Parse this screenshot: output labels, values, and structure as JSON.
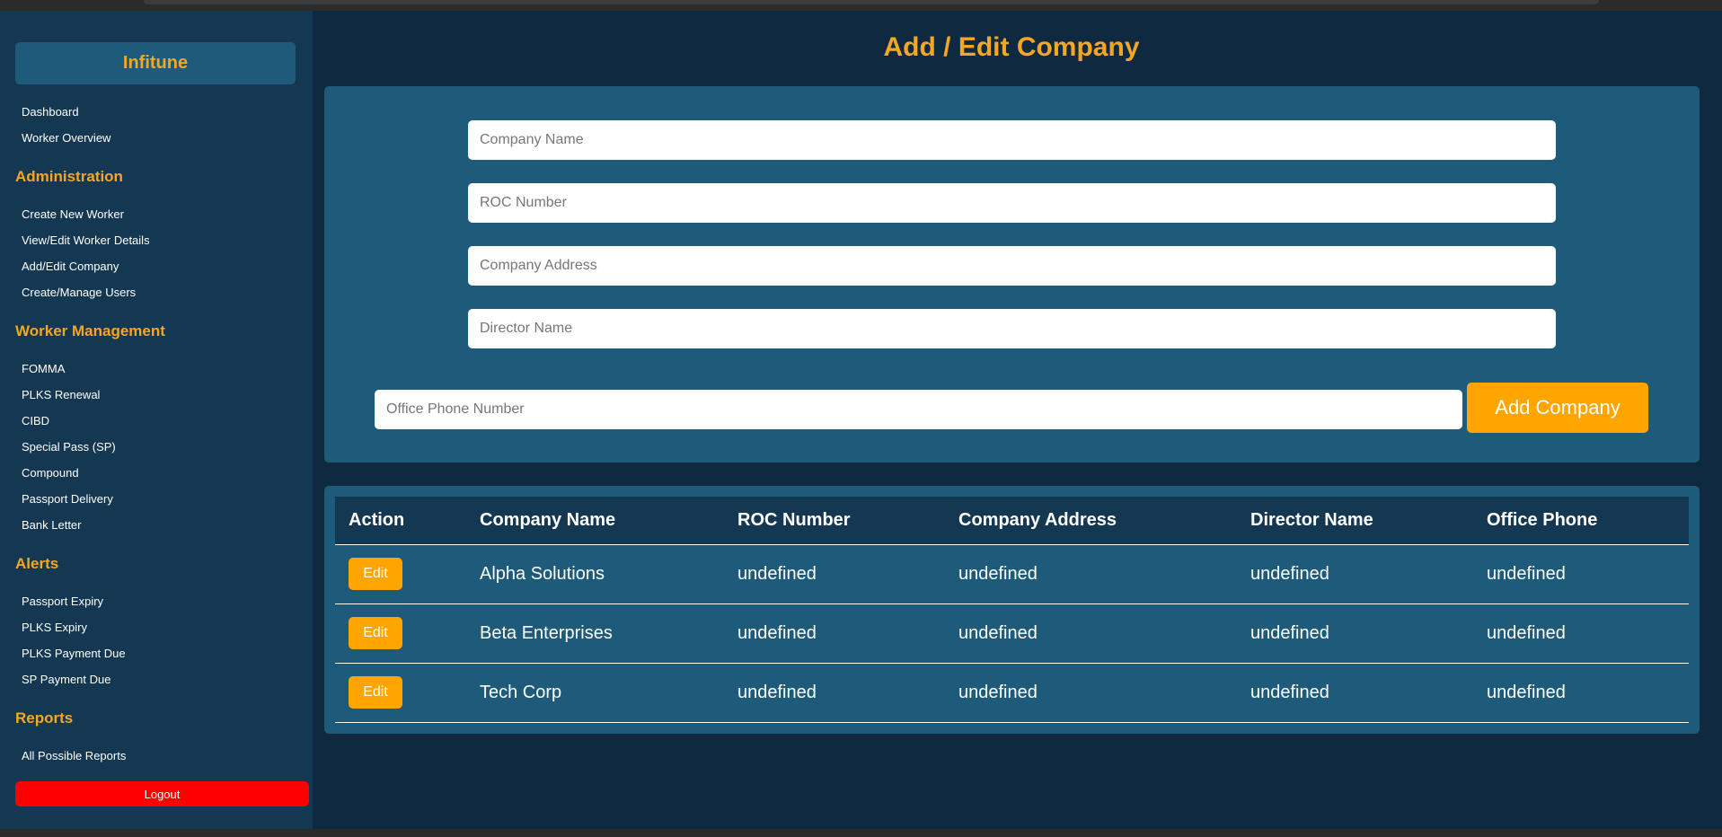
{
  "sidebar": {
    "brand": "Infitune",
    "top_links": [
      "Dashboard",
      "Worker Overview"
    ],
    "sections": [
      {
        "heading": "Administration",
        "items": [
          "Create New Worker",
          "View/Edit Worker Details",
          "Add/Edit Company",
          "Create/Manage Users"
        ]
      },
      {
        "heading": "Worker Management",
        "items": [
          "FOMMA",
          "PLKS Renewal",
          "CIBD",
          "Special Pass (SP)",
          "Compound",
          "Passport Delivery",
          "Bank Letter"
        ]
      },
      {
        "heading": "Alerts",
        "items": [
          "Passport Expiry",
          "PLKS Expiry",
          "PLKS Payment Due",
          "SP Payment Due"
        ]
      },
      {
        "heading": "Reports",
        "items": [
          "All Possible Reports"
        ]
      }
    ],
    "logout_label": "Logout"
  },
  "main": {
    "title": "Add / Edit Company",
    "form": {
      "company_name": {
        "placeholder": "Company Name",
        "value": ""
      },
      "roc_number": {
        "placeholder": "ROC Number",
        "value": ""
      },
      "company_address": {
        "placeholder": "Company Address",
        "value": ""
      },
      "director_name": {
        "placeholder": "Director Name",
        "value": ""
      },
      "office_phone": {
        "placeholder": "Office Phone Number",
        "value": ""
      },
      "submit_label": "Add Company"
    },
    "table": {
      "headers": [
        "Action",
        "Company Name",
        "ROC Number",
        "Company Address",
        "Director Name",
        "Office Phone"
      ],
      "edit_label": "Edit",
      "rows": [
        {
          "company_name": "Alpha Solutions",
          "roc_number": "undefined",
          "company_address": "undefined",
          "director_name": "undefined",
          "office_phone": "undefined"
        },
        {
          "company_name": "Beta Enterprises",
          "roc_number": "undefined",
          "company_address": "undefined",
          "director_name": "undefined",
          "office_phone": "undefined"
        },
        {
          "company_name": "Tech Corp",
          "roc_number": "undefined",
          "company_address": "undefined",
          "director_name": "undefined",
          "office_phone": "undefined"
        }
      ]
    }
  },
  "colors": {
    "accent": "#ffa500",
    "heading_orange": "#f5a623",
    "sidebar_bg": "#143752",
    "main_bg": "#0f2a40",
    "panel_bg": "#1e5a7a",
    "logout_red": "#ff0000"
  }
}
